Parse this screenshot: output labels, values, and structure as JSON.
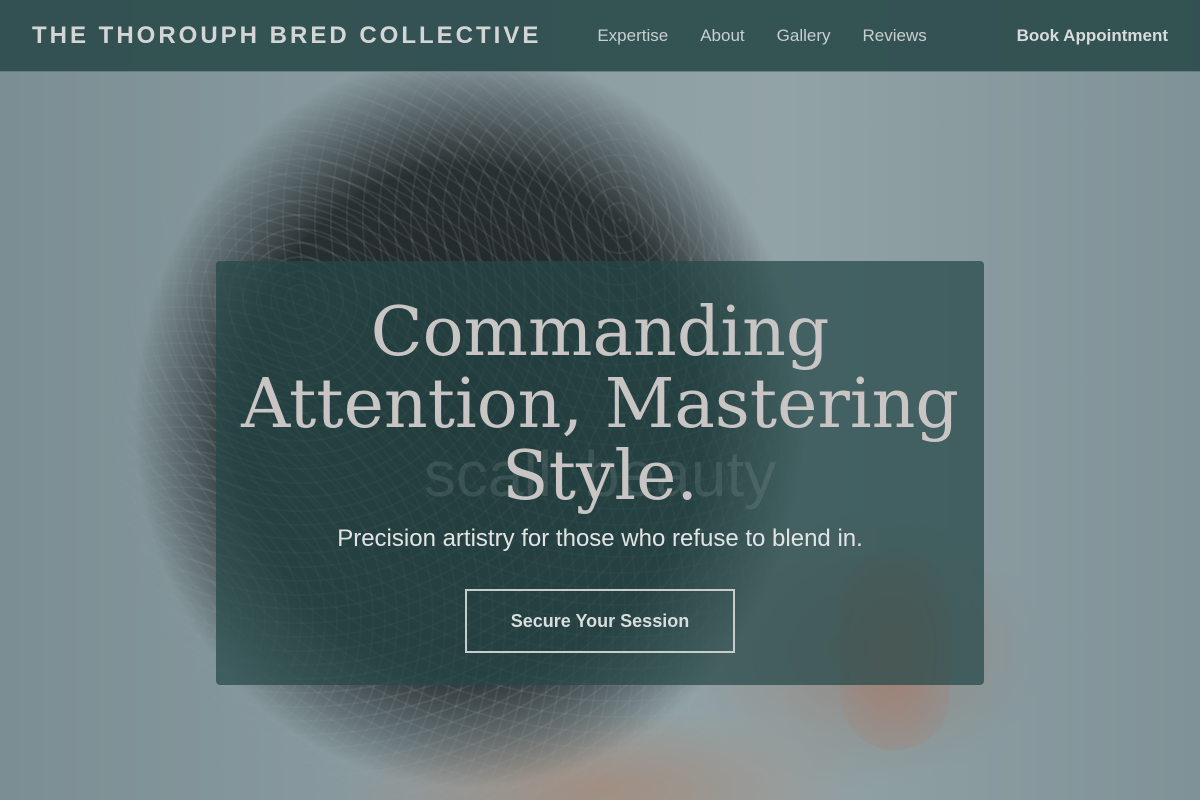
{
  "header": {
    "brand": "THE THOROUPH BRED COLLECTIVE",
    "nav": [
      {
        "label": "Expertise"
      },
      {
        "label": "About"
      },
      {
        "label": "Gallery"
      },
      {
        "label": "Reviews"
      }
    ],
    "book_label": "Book Appointment"
  },
  "hero": {
    "title_line1": "Commanding",
    "title_line2": "Attention, Mastering",
    "title_line3": "Style.",
    "ghost_text": "scalli beauty",
    "subtitle": "Precision artistry for those who refuse to blend in.",
    "cta_label": "Secure Your Session"
  },
  "colors": {
    "nav_background": "#2c4c4c",
    "card_background": "#264848",
    "title_text": "#c9c5c5",
    "cta_border": "#c7cccc"
  }
}
